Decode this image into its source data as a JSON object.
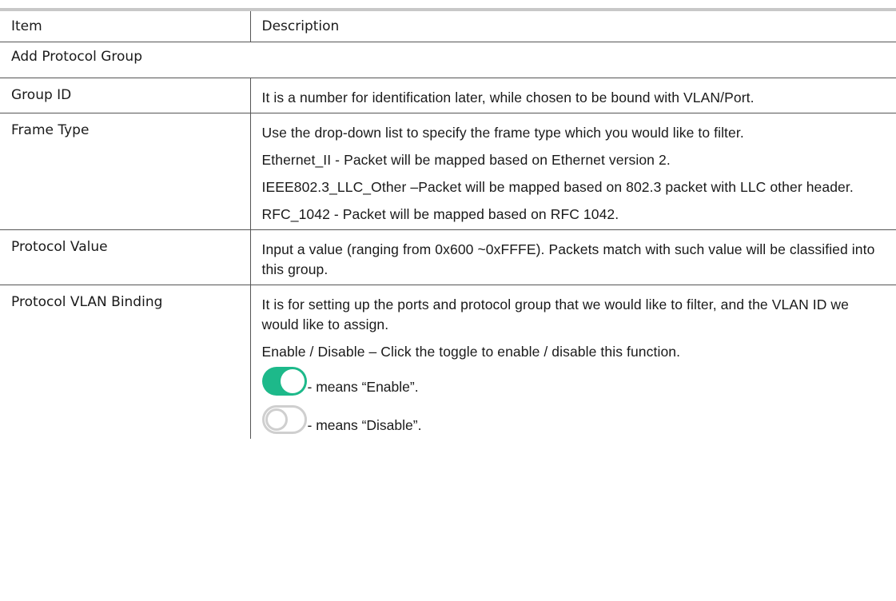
{
  "table": {
    "header": {
      "item": "Item",
      "description": "Description"
    },
    "section_title": "Add Protocol Group",
    "rows": [
      {
        "item": "Group ID",
        "paragraphs": [
          "It is a number for identification later, while chosen to be bound with VLAN/Port."
        ]
      },
      {
        "item": "Frame Type",
        "paragraphs": [
          "Use the drop-down list to specify the frame type which you would like to filter.",
          "Ethernet_II - Packet will be mapped based on Ethernet version 2.",
          "IEEE802.3_LLC_Other –Packet will be mapped based on 802.3 packet with LLC other header.",
          "RFC_1042 - Packet will be mapped based on RFC 1042."
        ]
      },
      {
        "item": "Protocol Value",
        "paragraphs": [
          "Input a value (ranging from 0x600 ~0xFFFE). Packets match with such value will be classified into this group."
        ]
      },
      {
        "item": "Protocol VLAN Binding",
        "paragraphs": [
          "It is for setting up the ports and protocol group that we would like to filter, and the VLAN ID we would like to assign.",
          "Enable / Disable – Click the toggle to enable / disable this function."
        ],
        "toggles": [
          {
            "state": "on",
            "icon": "toggle-on-icon",
            "label": "- means “Enable”."
          },
          {
            "state": "off",
            "icon": "toggle-off-icon",
            "label": "- means “Disable”."
          }
        ]
      }
    ]
  },
  "colors": {
    "toggle_on": "#1db98a",
    "toggle_off": "#cfcfcf",
    "top_rule": "#c8c8c8"
  }
}
